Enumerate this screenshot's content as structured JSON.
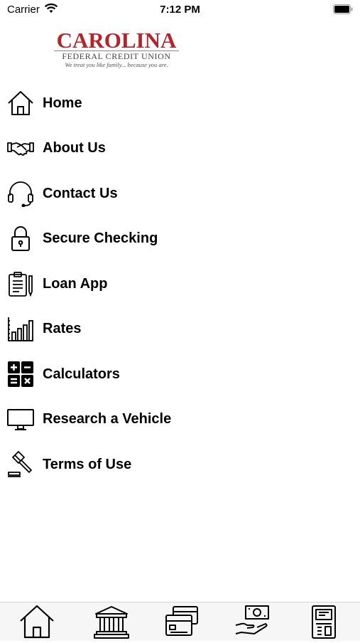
{
  "status": {
    "carrier": "Carrier",
    "time": "7:12 PM"
  },
  "logo": {
    "name": "CAROLINA",
    "subtitle": "FEDERAL CREDIT UNION",
    "tagline": "We treat you like family... because you are."
  },
  "menu": [
    {
      "label": "Home",
      "icon": "home-icon"
    },
    {
      "label": "About Us",
      "icon": "handshake-icon"
    },
    {
      "label": "Contact Us",
      "icon": "headset-icon"
    },
    {
      "label": "Secure Checking",
      "icon": "lock-icon"
    },
    {
      "label": "Loan App",
      "icon": "clipboard-icon"
    },
    {
      "label": "Rates",
      "icon": "bar-chart-icon"
    },
    {
      "label": "Calculators",
      "icon": "calculator-icon"
    },
    {
      "label": "Research a Vehicle",
      "icon": "monitor-icon"
    },
    {
      "label": "Terms of Use",
      "icon": "gavel-icon"
    }
  ],
  "tabs": [
    {
      "icon": "home-icon"
    },
    {
      "icon": "bank-icon"
    },
    {
      "icon": "cards-icon"
    },
    {
      "icon": "money-hand-icon"
    },
    {
      "icon": "atm-icon"
    }
  ]
}
